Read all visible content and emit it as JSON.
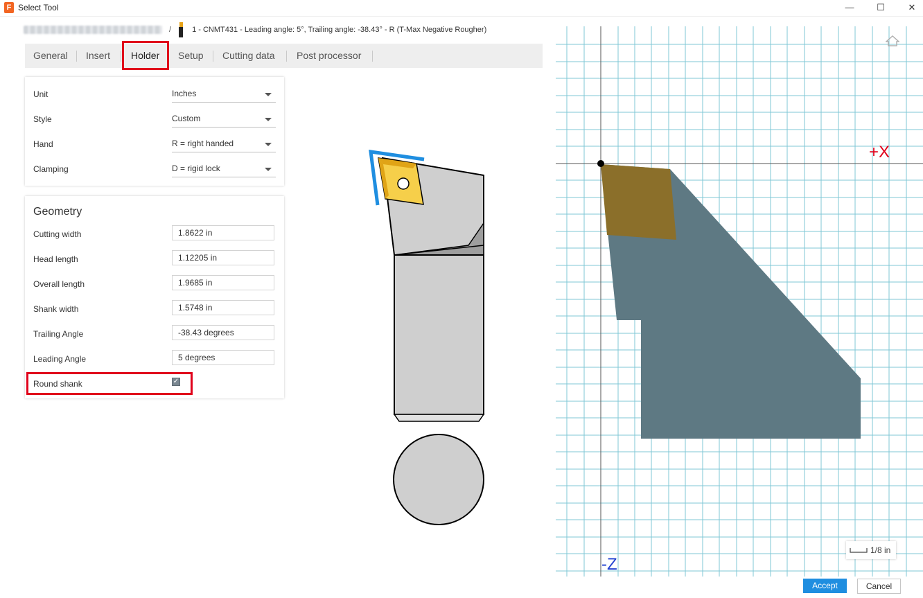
{
  "window": {
    "title": "Select Tool",
    "minimize_glyph": "—",
    "maximize_glyph": "☐",
    "close_glyph": "✕"
  },
  "breadcrumb": {
    "separator": "/",
    "tool_title": "1 - CNMT431 - Leading angle: 5°, Trailing angle: -38.43° - R (T-Max Negative Rougher)"
  },
  "tabs": [
    {
      "label": "General"
    },
    {
      "label": "Insert"
    },
    {
      "label": "Holder",
      "active": true
    },
    {
      "label": "Setup"
    },
    {
      "label": "Cutting data"
    },
    {
      "label": "Post processor"
    }
  ],
  "holder_settings": {
    "unit": {
      "label": "Unit",
      "value": "Inches"
    },
    "style": {
      "label": "Style",
      "value": "Custom"
    },
    "hand": {
      "label": "Hand",
      "value": "R = right handed"
    },
    "clamping": {
      "label": "Clamping",
      "value": "D = rigid lock"
    }
  },
  "geometry": {
    "title": "Geometry",
    "cutting_width": {
      "label": "Cutting width",
      "value": "1.8622 in"
    },
    "head_length": {
      "label": "Head length",
      "value": "1.12205 in"
    },
    "overall_length": {
      "label": "Overall length",
      "value": "1.9685 in"
    },
    "shank_width": {
      "label": "Shank width",
      "value": "1.5748 in"
    },
    "trailing_angle": {
      "label": "Trailing Angle",
      "value": "-38.43 degrees"
    },
    "leading_angle": {
      "label": "Leading Angle",
      "value": "5 degrees"
    },
    "round_shank": {
      "label": "Round shank",
      "checked": true
    }
  },
  "viewport": {
    "x_axis_label": "+X",
    "z_axis_label": "-Z",
    "scale_label": "1/8 in"
  },
  "colors": {
    "accent": "#1f8ee0",
    "highlight": "#e0001b",
    "grid_line": "#7fc7d6",
    "holder_fill": "#5e7983",
    "insert_fill": "#8b6f2a",
    "insert_yellow": "#f6cf4a",
    "axis_red": "#e0001b",
    "axis_blue": "#1f3fd0"
  },
  "icons": {
    "home": "home-icon",
    "app": "fusion-app-icon",
    "checkbox": "check-icon",
    "dropdown": "chevron-down-icon"
  },
  "actions": {
    "accept": "Accept",
    "cancel": "Cancel"
  }
}
